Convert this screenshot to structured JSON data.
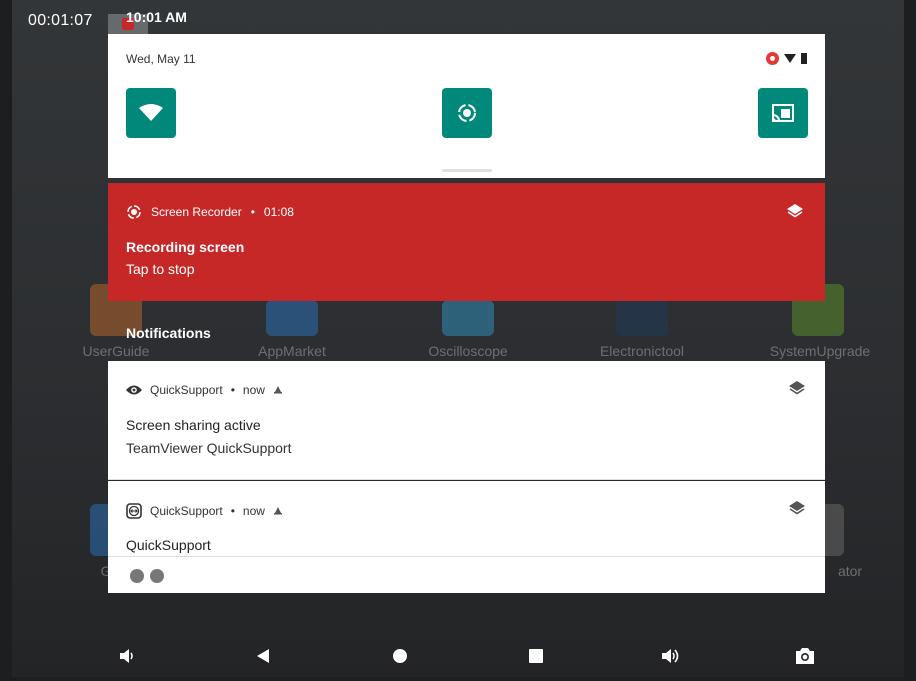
{
  "recording_timer": "00:01:07",
  "status_time": "10:01 AM",
  "background_apps": [
    {
      "label": "UserGuide",
      "color": "#b5642b"
    },
    {
      "label": "AppMarket",
      "color": "#2b6db5"
    },
    {
      "label": "Oscilloscope",
      "color": "#2b8bb5"
    },
    {
      "label": "Electronictool",
      "color": "#1f3a5a"
    },
    {
      "label": "SystemUpgrade",
      "color": "#5a8a2b"
    },
    {
      "label": "Ga",
      "color": "#2b6db5"
    },
    {
      "label": "ator",
      "color": "#666666"
    }
  ],
  "quick_settings": {
    "date": "Wed, May 11",
    "tiles": [
      {
        "icon": "wifi-icon"
      },
      {
        "icon": "screen-record-icon"
      },
      {
        "icon": "cast-icon"
      }
    ],
    "accent_color": "#00897b"
  },
  "recorder": {
    "app": "Screen Recorder",
    "separator": "•",
    "time": "01:08",
    "title": "Recording screen",
    "text": "Tap to stop",
    "color": "#c62828"
  },
  "notifications_header": "Notifications",
  "notifications": [
    {
      "app": "QuickSupport",
      "when": "now",
      "separator": "•",
      "title": "Screen sharing active",
      "text": "TeamViewer QuickSupport"
    },
    {
      "app": "QuickSupport",
      "when": "now",
      "separator": "•",
      "title": "QuickSupport"
    }
  ],
  "nav": [
    "volume-down-icon",
    "back-icon",
    "home-icon",
    "recents-icon",
    "volume-up-icon",
    "screenshot-icon"
  ]
}
